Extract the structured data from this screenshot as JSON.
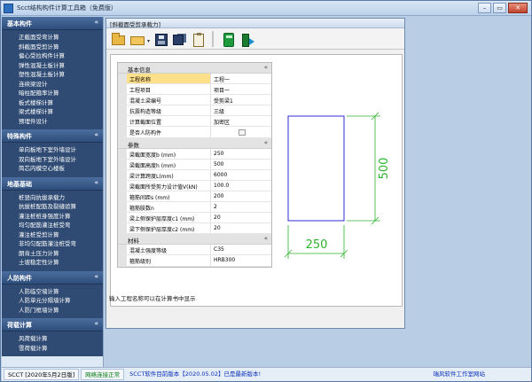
{
  "window": {
    "title": "Scct结构构件计算工具箱（免费版）",
    "buttons": {
      "minimize": "–",
      "maximize": "□",
      "restore": "▭",
      "close": "✕"
    }
  },
  "nav": {
    "sections": [
      {
        "title": "基本构件",
        "items": [
          "正截面受弯计算",
          "斜截面受剪计算",
          "偏心受拉构件计算",
          "弹性混凝土板计算",
          "塑性混凝土板计算",
          "连续梁设计",
          "暗柱配箍率计算",
          "板式楼梯计算",
          "梁式楼梯计算",
          "预埋件设计"
        ]
      },
      {
        "title": "特殊构件",
        "items": [
          "单向板地下室外墙设计",
          "双向板地下室外墙设计",
          "简芯内模空心楼板"
        ]
      },
      {
        "title": "地基基础",
        "items": [
          "桩竖向抗拔承载力",
          "抗拔桩配筋及裂缝验算",
          "灌注桩桩身强度计算",
          "均匀配筋灌注桩受弯",
          "灌注桩受剪计算",
          "非均匀配筋灌注桩受弯",
          "朗肯土压力计算",
          "土坡稳定性计算"
        ]
      },
      {
        "title": "人防构件",
        "items": [
          "人防临空墙计算",
          "人防单元分隔墙计算",
          "人防门框墙计算"
        ]
      },
      {
        "title": "荷载计算",
        "items": [
          "风荷载计算",
          "雪荷载计算"
        ]
      }
    ],
    "collapse_glyph": "«"
  },
  "child": {
    "title": "[斜截面受剪承载力]",
    "description": "输入工程名称可以在计算书中显示"
  },
  "grid": {
    "sections": [
      {
        "title": "基本信息",
        "rows": [
          {
            "name": "工程名称",
            "value": "工程一"
          },
          {
            "name": "工程项目",
            "value": "项目一"
          },
          {
            "name": "混凝土梁编号",
            "value": "受剪梁1"
          },
          {
            "name": "抗震构造等级",
            "value": "三级"
          },
          {
            "name": "计算截面位置",
            "value": "加密区"
          },
          {
            "name": "是否人防构件",
            "value": ""
          }
        ]
      },
      {
        "title": "参数",
        "rows": [
          {
            "name": "梁截面宽度b (mm)",
            "value": "250"
          },
          {
            "name": "梁截面高度h (mm)",
            "value": "500"
          },
          {
            "name": "梁计算跨度L(mm)",
            "value": "6000"
          },
          {
            "name": "梁截面所受剪力设计值V(kN)",
            "value": "100.0"
          },
          {
            "name": "箍筋间距s (mm)",
            "value": "200"
          },
          {
            "name": "箍筋肢数n",
            "value": "2"
          },
          {
            "name": "梁上侧保护层厚度c1 (mm)",
            "value": "20"
          },
          {
            "name": "梁下侧保护层厚度c2 (mm)",
            "value": "20"
          }
        ]
      },
      {
        "title": "材料",
        "rows": [
          {
            "name": "混凝土强度等级",
            "value": "C35"
          },
          {
            "name": "箍筋级别",
            "value": "HRB300"
          }
        ]
      }
    ],
    "collapse_glyph": "«",
    "is_civil_defense_checked": false
  },
  "drawing": {
    "width_label": "250",
    "height_label": "500",
    "section_color": "#2b2bd6",
    "dimension_color": "#2bb22b"
  },
  "statusbar": {
    "version": "SCCT  [2020年5月2日版]",
    "status": "网络连接正常",
    "notice": "SCCT软件目前版本【2020.05.02】已是最新版本!",
    "org": "瑞风软件工作室网站"
  },
  "colors": {
    "nav_header": "#2e4e7c",
    "nav_body": "#2f4b73",
    "selected_field": "#ffe08a"
  }
}
